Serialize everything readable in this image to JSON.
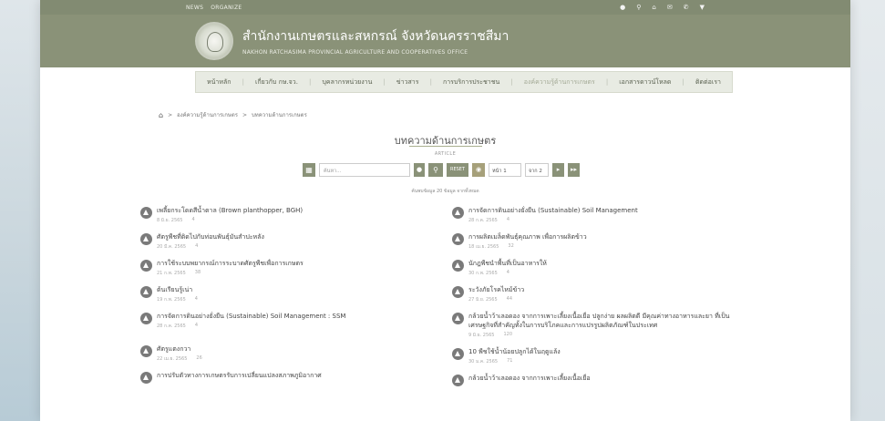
{
  "topbar": {
    "links": [
      "NEWS",
      "ORGANIZE"
    ],
    "icons": [
      "user-icon",
      "search-icon",
      "home-icon",
      "mail-icon",
      "phone-icon",
      "pin-icon"
    ]
  },
  "header": {
    "title": "สำนักงานเกษตรและสหกรณ์ จังหวัดนครราชสีมา",
    "subtitle": "NAKHON RATCHASIMA PROVINCIAL AGRICULTURE AND COOPERATIVES OFFICE"
  },
  "nav": {
    "items": [
      "หน้าหลัก",
      "เกี่ยวกับ กษ.จว.",
      "บุคลากรหน่วยงาน",
      "ข่าวสาร",
      "การบริการประชาชน",
      "องค์ความรู้ด้านการเกษตร",
      "เอกสารดาวน์โหลด",
      "ติดต่อเรา"
    ],
    "active_index": 5
  },
  "breadcrumb": {
    "items": [
      "องค์ความรู้ด้านการเกษตร",
      "บทความด้านการเกษตร"
    ]
  },
  "page": {
    "title": "บทความด้านการเกษตร",
    "subtitle": "ARTICLE",
    "count_text": "ค้นพบข้อมูล 20 ข้อมูล จากทั้งหมด"
  },
  "toolbar": {
    "search_placeholder": "ค้นหา...",
    "reset_label": "RESET",
    "page_select": "หน้า 1",
    "page_total": "จาก 2"
  },
  "articles_left": [
    {
      "title": "เพลี้ยกระโดดสีน้ำตาล (Brown planthopper, BGH)",
      "date": "8 มิ.ย. 2565",
      "views": "4"
    },
    {
      "title": "ศัตรูพืชที่ติดไปกับท่อนพันธุ์มันสำปะหลัง",
      "date": "20 มี.ค. 2565",
      "views": "4"
    },
    {
      "title": "การใช้ระบบพยากรณ์การระบาดศัตรูพืชเพื่อการเกษตร",
      "date": "21 ก.พ. 2565",
      "views": "38"
    },
    {
      "title": "ต้นเรียนรู้เน่า",
      "date": "19 ก.พ. 2565",
      "views": "4"
    },
    {
      "title": "การจัดการดินอย่างยั่งยืน (Sustainable) Soil Management : SSM",
      "date": "28 ก.ค. 2565",
      "views": "4"
    },
    {
      "title": "ศัตรูแตงกวา",
      "date": "22 เม.ย. 2565",
      "views": "26"
    },
    {
      "title": "การปรับตัวทางการเกษตรรับการเปลี่ยนแปลงสภาพภูมิอากาศ",
      "date": "",
      "views": ""
    }
  ],
  "articles_right": [
    {
      "title": "การจัดการดินอย่างยั่งยืน (Sustainable) Soil Management",
      "date": "28 ก.ค. 2565",
      "views": "4"
    },
    {
      "title": "การผลิตเมล็ดพันธุ์คุณภาพ เพื่อการผลิตข้าว",
      "date": "18 เม.ย. 2565",
      "views": "32"
    },
    {
      "title": "นักฎพืชนำพื้นที่เป็นอาหารให้",
      "date": "30 ก.พ. 2565",
      "views": "4"
    },
    {
      "title": "ระวังภัยโรคไหม้ข้าว",
      "date": "27 มิ.ย. 2565",
      "views": "44"
    },
    {
      "title": "กล้วยน้ำว้าเลอดอง จากการเพาะเลี้ยงเนื้อเยื่อ ปลูกง่าย ผลผลิตดี มีคุณค่าทางอาหารและยา ที่เป็นเศรษฐกิจที่สำคัญทั้งในการบริโภคและการแปรรูปผลิตภัณฑ์ในประเทศ",
      "date": "9 มิ.ย. 2565",
      "views": "120"
    },
    {
      "title": "10 พืชใช้น้ำน้อยปลูกได้ในฤดูแล้ง",
      "date": "30 ม.ค. 2565",
      "views": "71"
    },
    {
      "title": "กล้วยน้ำว้าเลอดอง จากการเพาะเลี้ยงเนื้อเยื่อ",
      "date": "",
      "views": ""
    }
  ]
}
